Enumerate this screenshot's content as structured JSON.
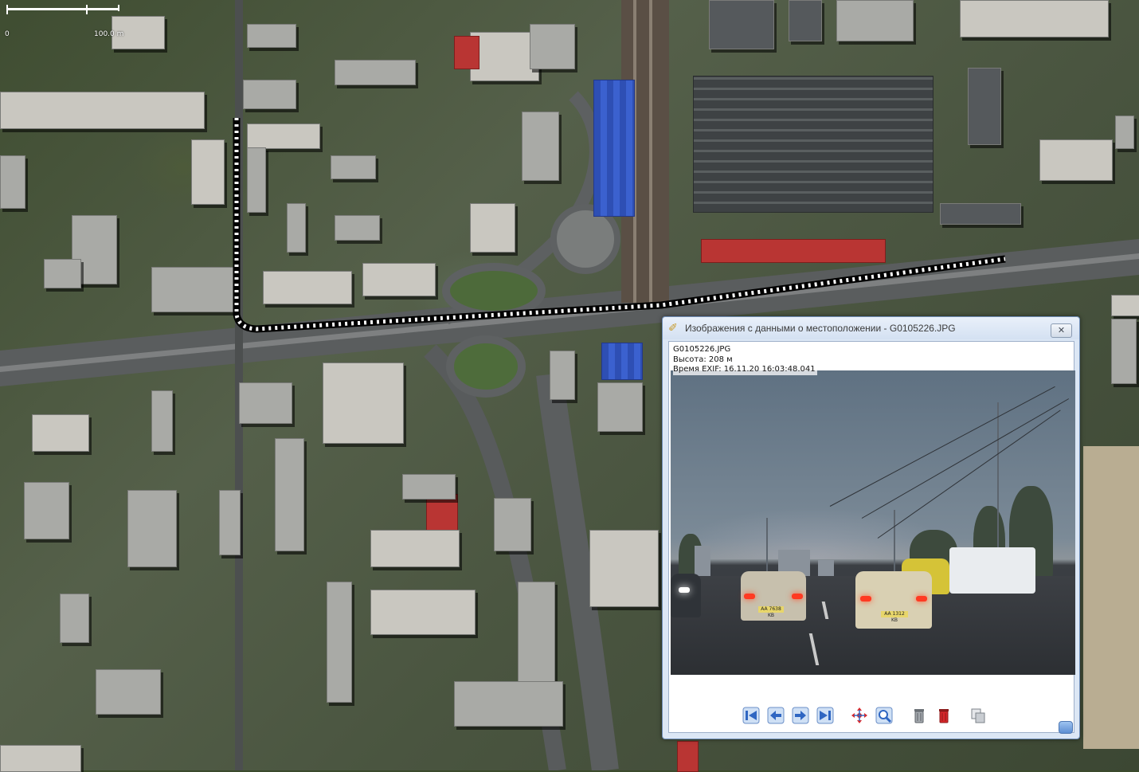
{
  "map": {
    "scale_labels": [
      "0",
      "100.0 m"
    ]
  },
  "dialog": {
    "title": "Изображения с данными о местоположении - G0105226.JPG",
    "info": {
      "filename": "G0105226.JPG",
      "altitude": "Высота: 208 м",
      "exif_time": "Время EXIF: 16.11.20 16:03:48.041"
    },
    "plates": [
      "AA 7638 KB",
      "AA 1312 KB"
    ],
    "close_glyph": "✕",
    "toolbar": {
      "buttons": [
        "first-image",
        "previous-image",
        "next-image",
        "last-image",
        "move-marker",
        "zoom-to-image",
        "delete-image",
        "delete-all-images",
        "copy-image"
      ]
    }
  },
  "colors": {
    "titlebar": "#dce7f5",
    "accent_blue": "#3f74c6",
    "track": "#ffffff"
  }
}
